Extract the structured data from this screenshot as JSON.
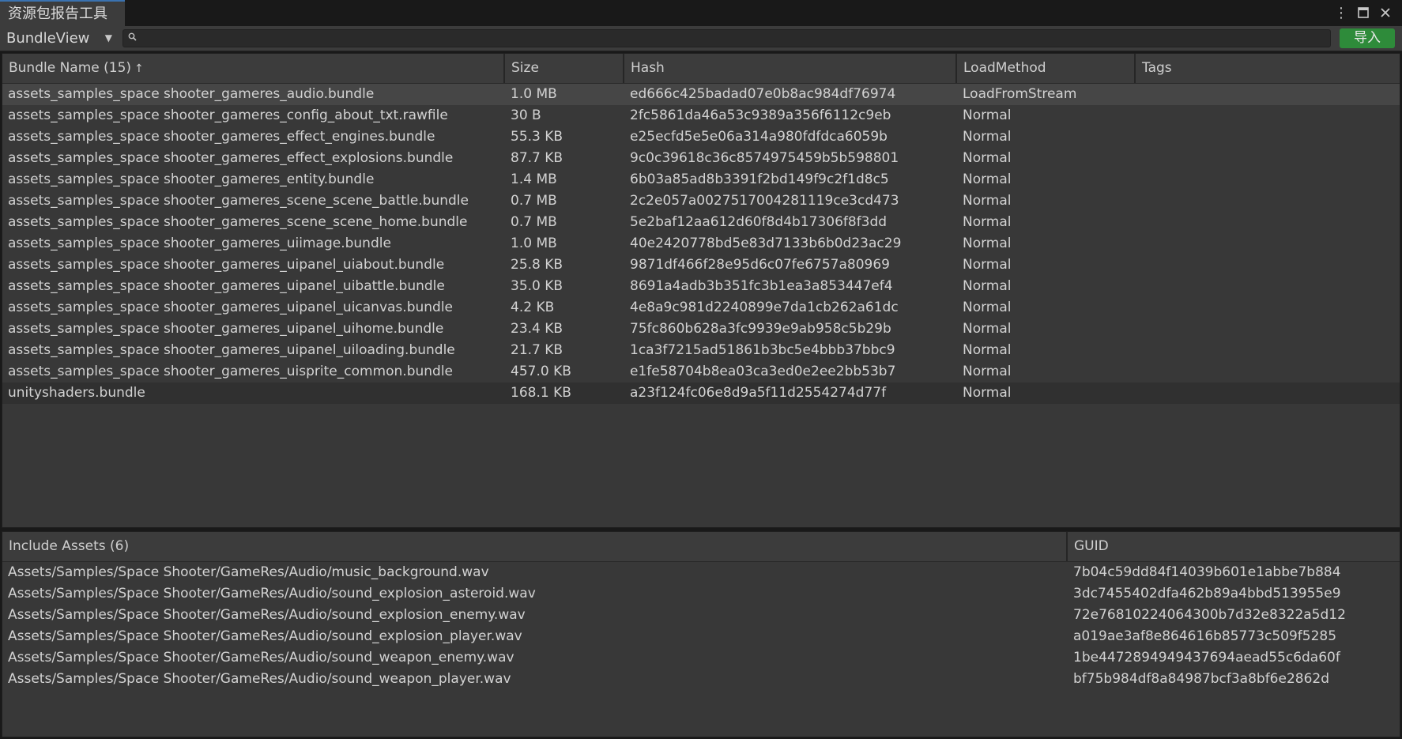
{
  "window": {
    "title": "资源包报告工具"
  },
  "toolbar": {
    "view_select": "BundleView",
    "search_value": "",
    "import_label": "导入"
  },
  "bundles": {
    "headers": [
      "Bundle Name (15)",
      "Size",
      "Hash",
      "LoadMethod",
      "Tags"
    ],
    "sorted_column": "Bundle Name",
    "rows": [
      {
        "name": "assets_samples_space shooter_gameres_audio.bundle",
        "size": "1.0 MB",
        "hash": "ed666c425badad07e0b8ac984df76974",
        "load": "LoadFromStream",
        "tags": ""
      },
      {
        "name": "assets_samples_space shooter_gameres_config_about_txt.rawfile",
        "size": "30 B",
        "hash": "2fc5861da46a53c9389a356f6112c9eb",
        "load": "Normal",
        "tags": ""
      },
      {
        "name": "assets_samples_space shooter_gameres_effect_engines.bundle",
        "size": "55.3 KB",
        "hash": "e25ecfd5e5e06a314a980fdfdca6059b",
        "load": "Normal",
        "tags": ""
      },
      {
        "name": "assets_samples_space shooter_gameres_effect_explosions.bundle",
        "size": "87.7 KB",
        "hash": "9c0c39618c36c8574975459b5b598801",
        "load": "Normal",
        "tags": ""
      },
      {
        "name": "assets_samples_space shooter_gameres_entity.bundle",
        "size": "1.4 MB",
        "hash": "6b03a85ad8b3391f2bd149f9c2f1d8c5",
        "load": "Normal",
        "tags": ""
      },
      {
        "name": "assets_samples_space shooter_gameres_scene_scene_battle.bundle",
        "size": "0.7 MB",
        "hash": "2c2e057a0027517004281119ce3cd473",
        "load": "Normal",
        "tags": ""
      },
      {
        "name": "assets_samples_space shooter_gameres_scene_scene_home.bundle",
        "size": "0.7 MB",
        "hash": "5e2baf12aa612d60f8d4b17306f8f3dd",
        "load": "Normal",
        "tags": ""
      },
      {
        "name": "assets_samples_space shooter_gameres_uiimage.bundle",
        "size": "1.0 MB",
        "hash": "40e2420778bd5e83d7133b6b0d23ac29",
        "load": "Normal",
        "tags": ""
      },
      {
        "name": "assets_samples_space shooter_gameres_uipanel_uiabout.bundle",
        "size": "25.8 KB",
        "hash": "9871df466f28e95d6c07fe6757a80969",
        "load": "Normal",
        "tags": ""
      },
      {
        "name": "assets_samples_space shooter_gameres_uipanel_uibattle.bundle",
        "size": "35.0 KB",
        "hash": "8691a4adb3b351fc3b1ea3a853447ef4",
        "load": "Normal",
        "tags": ""
      },
      {
        "name": "assets_samples_space shooter_gameres_uipanel_uicanvas.bundle",
        "size": "4.2 KB",
        "hash": "4e8a9c981d2240899e7da1cb262a61dc",
        "load": "Normal",
        "tags": ""
      },
      {
        "name": "assets_samples_space shooter_gameres_uipanel_uihome.bundle",
        "size": "23.4 KB",
        "hash": "75fc860b628a3fc9939e9ab958c5b29b",
        "load": "Normal",
        "tags": ""
      },
      {
        "name": "assets_samples_space shooter_gameres_uipanel_uiloading.bundle",
        "size": "21.7 KB",
        "hash": "1ca3f7215ad51861b3bc5e4bbb37bbc9",
        "load": "Normal",
        "tags": ""
      },
      {
        "name": "assets_samples_space shooter_gameres_uisprite_common.bundle",
        "size": "457.0 KB",
        "hash": "e1fe58704b8ea03ca3ed0e2ee2bb53b7",
        "load": "Normal",
        "tags": ""
      },
      {
        "name": "unityshaders.bundle",
        "size": "168.1 KB",
        "hash": "a23f124fc06e8d9a5f11d2554274d77f",
        "load": "Normal",
        "tags": ""
      }
    ]
  },
  "assets": {
    "headers": [
      "Include Assets (6)",
      "GUID"
    ],
    "rows": [
      {
        "path": "Assets/Samples/Space Shooter/GameRes/Audio/music_background.wav",
        "guid": "7b04c59dd84f14039b601e1abbe7b884"
      },
      {
        "path": "Assets/Samples/Space Shooter/GameRes/Audio/sound_explosion_asteroid.wav",
        "guid": "3dc7455402dfa462b89a4bbd513955e9"
      },
      {
        "path": "Assets/Samples/Space Shooter/GameRes/Audio/sound_explosion_enemy.wav",
        "guid": "72e76810224064300b7d32e8322a5d12"
      },
      {
        "path": "Assets/Samples/Space Shooter/GameRes/Audio/sound_explosion_player.wav",
        "guid": "a019ae3af8e864616b85773c509f5285"
      },
      {
        "path": "Assets/Samples/Space Shooter/GameRes/Audio/sound_weapon_enemy.wav",
        "guid": "1be4472894949437694aead55c6da60f"
      },
      {
        "path": "Assets/Samples/Space Shooter/GameRes/Audio/sound_weapon_player.wav",
        "guid": "bf75b984df8a84987bcf3a8bf6e2862d"
      }
    ]
  },
  "colors": {
    "background": "#383838",
    "header": "#3c3c3c",
    "selection": "#464646",
    "import_button": "#2e8b3a",
    "text": "#d2d2d2"
  },
  "icons": {
    "menu": "kebab-menu-icon",
    "maximize": "maximize-icon",
    "close": "close-icon",
    "search": "search-icon",
    "dropdown": "chevron-down-icon",
    "sort": "sort-ascending-icon"
  }
}
